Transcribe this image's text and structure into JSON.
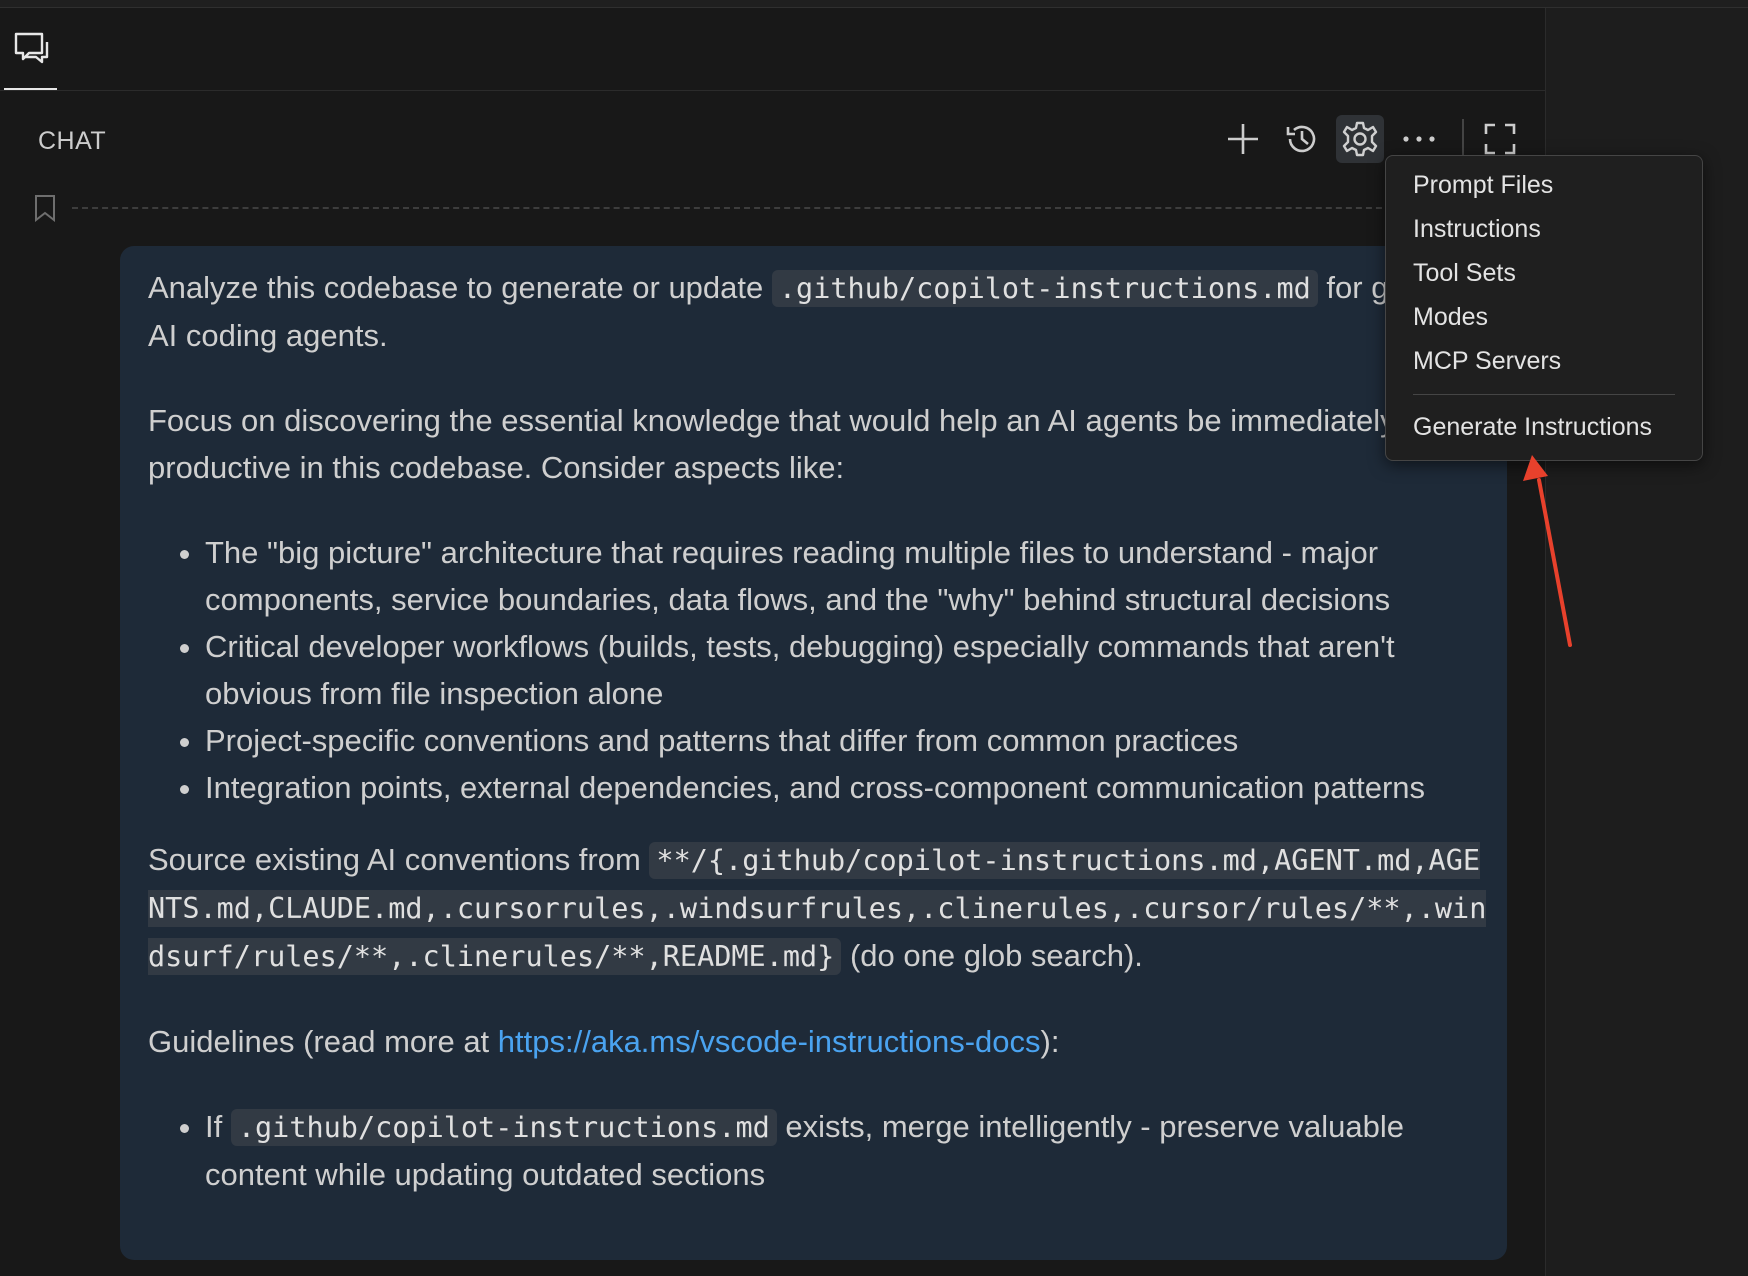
{
  "tabs": [
    {
      "name": "chat",
      "icon": "chat-bubbles-icon",
      "active": true
    }
  ],
  "header": {
    "title": "CHAT",
    "actions": [
      {
        "name": "new-chat",
        "icon": "plus-icon"
      },
      {
        "name": "history",
        "icon": "history-icon"
      },
      {
        "name": "configure",
        "icon": "gear-icon",
        "active": true
      },
      {
        "name": "more",
        "icon": "ellipsis-icon"
      },
      {
        "name": "maximize",
        "icon": "maximize-icon"
      }
    ]
  },
  "message": {
    "p1_text1": "Analyze this codebase to generate or update ",
    "p1_code": ".github/copilot-instructions.md",
    "p1_text2": " for guiding AI coding agents.",
    "p2": "Focus on discovering the essential knowledge that would help an AI agents be immediately productive in this codebase. Consider aspects like:",
    "bullets": [
      "The \"big picture\" architecture that requires reading multiple files to understand - major components, service boundaries, data flows, and the \"why\" behind structural decisions",
      "Critical developer workflows (builds, tests, debugging) especially commands that aren't obvious from file inspection alone",
      "Project-specific conventions and patterns that differ from common practices",
      "Integration points, external dependencies, and cross-component communication patterns"
    ],
    "p3_text1": "Source existing AI conventions from ",
    "p3_code": "**/{.github/copilot-instructions.md,AGENT.md,AGENTS.md,CLAUDE.md,.cursorrules,.windsurfrules,.clinerules,.cursor/rules/**,.windsurf/rules/**,.clinerules/**,README.md}",
    "p3_text2": " (do one glob search).",
    "p4_text1": "Guidelines (read more at ",
    "p4_link": "https://aka.ms/vscode-instructions-docs",
    "p4_text2": "):",
    "g1_text1": "If ",
    "g1_code": ".github/copilot-instructions.md",
    "g1_text2": " exists, merge intelligently - preserve valuable content while updating outdated sections"
  },
  "menu": {
    "items": [
      "Prompt Files",
      "Instructions",
      "Tool Sets",
      "Modes",
      "MCP Servers"
    ],
    "action": "Generate Instructions"
  },
  "colors": {
    "background": "#181818",
    "message_bg": "#1e2a38",
    "link": "#4aa3f0",
    "annotation_arrow": "#e8412c"
  }
}
